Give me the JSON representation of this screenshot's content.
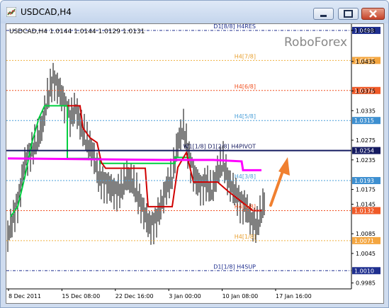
{
  "window": {
    "title": "USDCAD,H4",
    "icons": {
      "app": "chart-icon",
      "minimize": "minimize-icon",
      "maximize": "maximize-icon",
      "close": "close-icon"
    }
  },
  "chart_header": "USDCAD,H4  1.0144 1.0144 1.0129 1.0131",
  "watermark": "RoboForex",
  "chart_data": {
    "type": "line",
    "symbol": "USDCAD",
    "timeframe": "H4",
    "ohlc_last": {
      "open": 1.0144,
      "high": 1.0144,
      "low": 1.0129,
      "close": 1.0131
    },
    "y_ticks": [
      "1.0498",
      "1.0435",
      "1.0375",
      "1.0335",
      "1.0275",
      "1.0235",
      "1.0175",
      "1.0145",
      "1.0085",
      "1.0045",
      "0.9985"
    ],
    "x_ticks": [
      "8 Dec 2011",
      "15 Dec 08:00",
      "22 Dec 16:00",
      "3 Jan 00:00",
      "10 Jan 08:00",
      "17 Jan 16:00"
    ],
    "ylim": [
      0.9973,
      1.0508
    ],
    "levels": [
      {
        "label": "D1[8/8] H4RES",
        "value": 1.0498,
        "tag": "1.0498",
        "color": "#1f2f8f",
        "style": "dash-dot",
        "tag_bg": "#1f2f8f"
      },
      {
        "label": "H4[7/8]",
        "value": 1.0437,
        "tag": "1.0437",
        "color": "#f0b040",
        "style": "dotted",
        "tag_bg": "#f4a640"
      },
      {
        "label": "H4[6/8]",
        "value": 1.0376,
        "tag": "1.0376",
        "color": "#f05020",
        "style": "dotted",
        "tag_bg": "#f05a28"
      },
      {
        "label": "H4[5/8]",
        "value": 1.0315,
        "tag": "1.0315",
        "color": "#4a9fd8",
        "style": "dotted",
        "tag_bg": "#3d8fd0"
      },
      {
        "label": "W1[1/8] D1[2/8] H4PIVOT",
        "value": 1.0254,
        "tag": "1.0254",
        "color": "#141a60",
        "style": "solid",
        "tag_bg": "#141a60"
      },
      {
        "label": "H4[3/8]",
        "value": 1.0193,
        "tag": "1.0193",
        "color": "#4a9fd8",
        "style": "dotted",
        "tag_bg": "#3d8fd0"
      },
      {
        "label": "H4[2/8]",
        "value": 1.0132,
        "tag": "1.0132",
        "color": "#f05020",
        "style": "dotted",
        "tag_bg": "#f05a28"
      },
      {
        "label": "H4[1/8]",
        "value": 1.0071,
        "tag": "1.0071",
        "color": "#f0b040",
        "style": "dotted",
        "tag_bg": "#f4a640"
      },
      {
        "label": "D1[1/8] H4SUP",
        "value": 1.001,
        "tag": "1.0010",
        "color": "#1f2f8f",
        "style": "dash-dot",
        "tag_bg": "#1f2f8f"
      }
    ],
    "series": [
      {
        "color": "#00d040"
      },
      {
        "color": "#d00000"
      },
      {
        "color": "#ff00ff"
      },
      {
        "color": "#000000"
      }
    ],
    "annotation_arrow_color": "#f08030"
  }
}
